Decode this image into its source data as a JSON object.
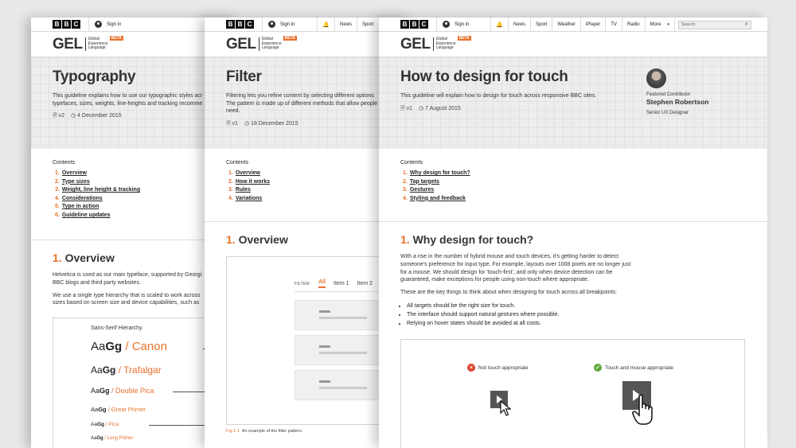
{
  "bbc_letters": [
    "B",
    "B",
    "C"
  ],
  "signin": "Sign in",
  "gel": {
    "logo": "GEL",
    "sub": [
      "Global",
      "Experience",
      "Language"
    ],
    "beta": "BETA"
  },
  "nav_short": [
    "News",
    "Sport"
  ],
  "nav_full": [
    "News",
    "Sport",
    "Weather",
    "iPlayer",
    "TV",
    "Radio",
    "More"
  ],
  "search_placeholder": "Search",
  "typography": {
    "title": "Typography",
    "desc1": "This guideline explains how to use our typographic styles acr",
    "desc2": "typefaces, sizes, weights, line-heights and tracking recomme",
    "version": "v2",
    "date": "4 December 2015",
    "contents_label": "Contents",
    "contents": [
      {
        "n": "1.",
        "label": "Overview"
      },
      {
        "n": "2.",
        "label": "Type sizes"
      },
      {
        "n": "3.",
        "label": "Weight, line height & tracking"
      },
      {
        "n": "4.",
        "label": "Considerations"
      },
      {
        "n": "5.",
        "label": "Type in action"
      },
      {
        "n": "6.",
        "label": "Guideline updates"
      }
    ],
    "section_num": "1.",
    "section_title": "Overview",
    "p1a": "Helvetica is used as our main typeface, supported by Georgi",
    "p1b": "BBC blogs and third party websites.",
    "p2a": "We use a single type hierarchy that is scaled to work across",
    "p2b": "sizes based on screen size and device capabilities, such as",
    "hierarchy_label": "Sans-Serif Hierarchy",
    "sample_light": "Aa",
    "sample_bold": "Gg",
    "hierarchy": [
      {
        "name": "/ Canon"
      },
      {
        "name": "/ Trafalgar"
      },
      {
        "name": "/ Double Pica"
      },
      {
        "name": "/ Great Primer"
      },
      {
        "name": "/ Pica"
      },
      {
        "name": "/ Long Primer"
      }
    ]
  },
  "filter": {
    "title": "Filter",
    "desc1": "Filtering lets you refine content by selecting different options",
    "desc2": "The pattern is made up of different methods that allow people",
    "desc3": "need.",
    "version": "v1",
    "date": "18 December 2015",
    "contents_label": "Contents",
    "contents": [
      {
        "n": "1.",
        "label": "Overview"
      },
      {
        "n": "2.",
        "label": "How it works"
      },
      {
        "n": "3.",
        "label": "Rules"
      },
      {
        "n": "4.",
        "label": "Variations"
      }
    ],
    "section_num": "1.",
    "section_title": "Overview",
    "filter_label": "FILTER:",
    "filter_tabs": [
      "All",
      "Item 1",
      "Item 2"
    ],
    "fig_caption_num": "Fig 1.1",
    "fig_caption": "An example of the filter pattern."
  },
  "touch": {
    "title": "How to design for touch",
    "desc": "This guideline will explain how to design for touch across responsive BBC sites.",
    "version": "v1",
    "date": "7 August 2015",
    "featured_label": "Featured Contributor",
    "contributor_name": "Stephen Robertson",
    "contributor_role": "Senior UX Designer",
    "contents_label": "Contents",
    "contents": [
      {
        "n": "1.",
        "label": "Why design for touch?"
      },
      {
        "n": "2.",
        "label": "Tap targets"
      },
      {
        "n": "3.",
        "label": "Gestures"
      },
      {
        "n": "4.",
        "label": "Styling and feedback"
      }
    ],
    "section_num": "1.",
    "section_title": "Why design for touch?",
    "para1": "With a rise in the number of hybrid mouse and touch devices, it's getting harder to detect someone's preference for input type. For example, layouts over 1008 pixels are no longer just for a mouse. We should design for 'touch-first', and only when device detection can be guaranteed, make exceptions for people using non-touch where appropriate.",
    "para2": "These are the key things to think about when designing for touch across all breakpoints:",
    "bullets": [
      "All targets should be the right size for touch.",
      "The interface should support natural gestures where possible.",
      "Relying on hover states should be avoided at all costs."
    ],
    "not_touch_label": "Not touch appropriate",
    "touch_label": "Touch and mouse appropriate"
  },
  "colors": {
    "accent": "#e8712c",
    "green": "#5fa83b",
    "red": "#d9442f"
  }
}
